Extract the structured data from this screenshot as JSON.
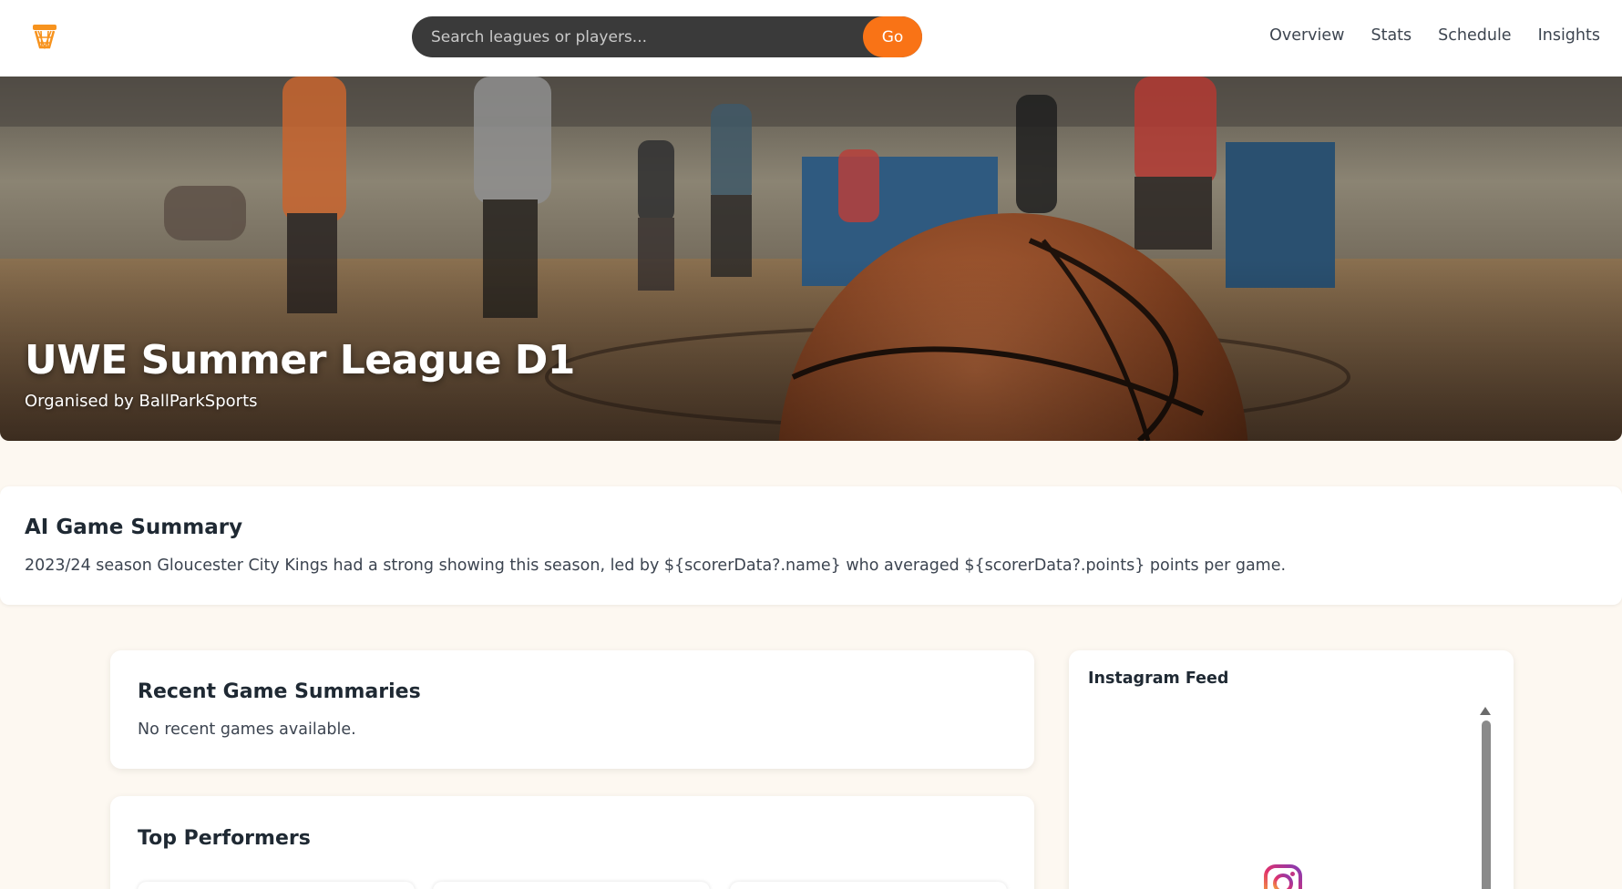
{
  "header": {
    "logo_icon": "basketball-hoop-icon",
    "search": {
      "placeholder": "Search leagues or players...",
      "button": "Go"
    },
    "nav": [
      "Overview",
      "Stats",
      "Schedule",
      "Insights"
    ]
  },
  "hero": {
    "title": "UWE Summer League D1",
    "subtitle": "Organised by BallParkSports",
    "image": "basketball-court-photo"
  },
  "ai_summary": {
    "title": "AI Game Summary",
    "text": "2023/24 season Gloucester City Kings had a strong showing this season, led by ${scorerData?.name} who averaged ${scorerData?.points} points per game."
  },
  "recent": {
    "title": "Recent Game Summaries",
    "empty_text": "No recent games available."
  },
  "top_performers": {
    "title": "Top Performers"
  },
  "instagram": {
    "title": "Instagram Feed",
    "icon": "instagram-icon"
  },
  "colors": {
    "accent": "#f97316",
    "background": "#fdf8f1",
    "search_bg": "#3a3a3a"
  }
}
